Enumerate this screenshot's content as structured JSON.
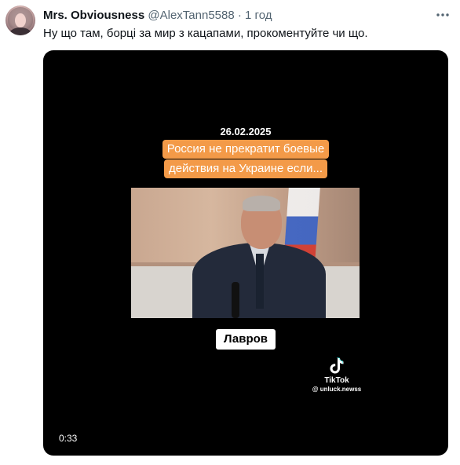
{
  "tweet": {
    "display_name": "Mrs. Obviousness",
    "handle": "@AlexTann5588",
    "separator": "·",
    "time": "1 год",
    "text": "Ну що там, борці за мир з кацапами, прокоментуйте чи що.",
    "more_icon": "more-horizontal-icon"
  },
  "video": {
    "date": "26.02.2025",
    "caption_lines": [
      "Россия не прекратит боевые",
      "действия на Украине если..."
    ],
    "name_label": "Лавров",
    "watermark": {
      "icon": "tiktok-logo-icon",
      "brand": "TikTok",
      "handle": "@ unluck.newss"
    },
    "duration": "0:33"
  },
  "colors": {
    "caption_bg": "#f39a48",
    "video_bg": "#000000",
    "secondary_text": "#536471"
  }
}
